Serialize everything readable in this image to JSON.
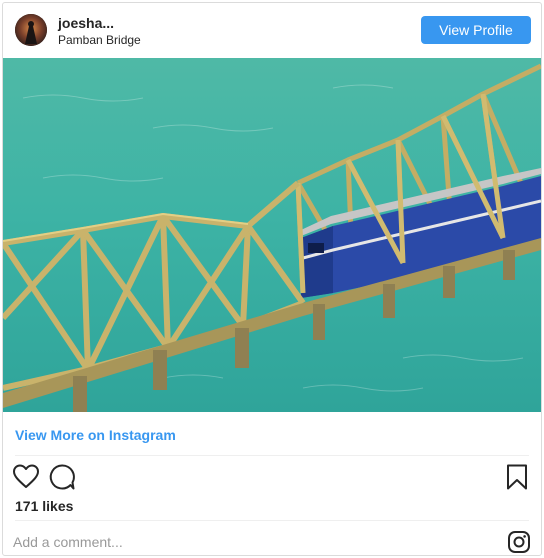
{
  "post": {
    "username": "joesha...",
    "location": "Pamban Bridge",
    "view_profile_label": "View Profile",
    "view_more_label": "View More on Instagram",
    "likes": "171 likes",
    "comment_placeholder": "Add a comment..."
  },
  "icons": {
    "heart": "heart-icon",
    "comment": "comment-icon",
    "bookmark": "bookmark-icon",
    "instagram": "instagram-logo-icon"
  },
  "colors": {
    "accent": "#3897f0",
    "sea": "#3fb5a3",
    "bridge": "#c9b36b",
    "train": "#2b4aa8"
  }
}
